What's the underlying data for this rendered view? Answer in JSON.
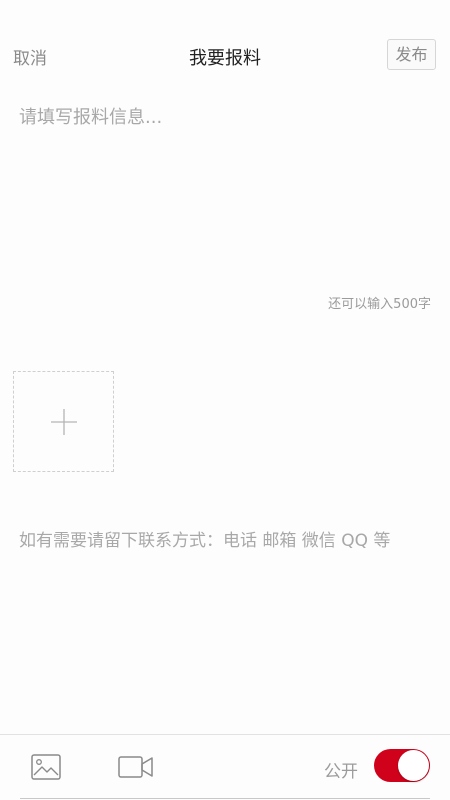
{
  "header": {
    "cancel_label": "取消",
    "title": "我要报料",
    "publish_label": "发布"
  },
  "report": {
    "content_placeholder": "请填写报料信息...",
    "char_count_text": "还可以输入500字",
    "contact_placeholder": "如有需要请留下联系方式：电话 邮箱 微信 QQ 等"
  },
  "media": {
    "add_icon": "plus-icon"
  },
  "bottom_bar": {
    "image_icon": "image-icon",
    "video_icon": "video-camera-icon",
    "public_label": "公开",
    "public_enabled": true
  },
  "colors": {
    "accent": "#d0021b",
    "placeholder": "#a8a8a8",
    "title": "#222222"
  }
}
